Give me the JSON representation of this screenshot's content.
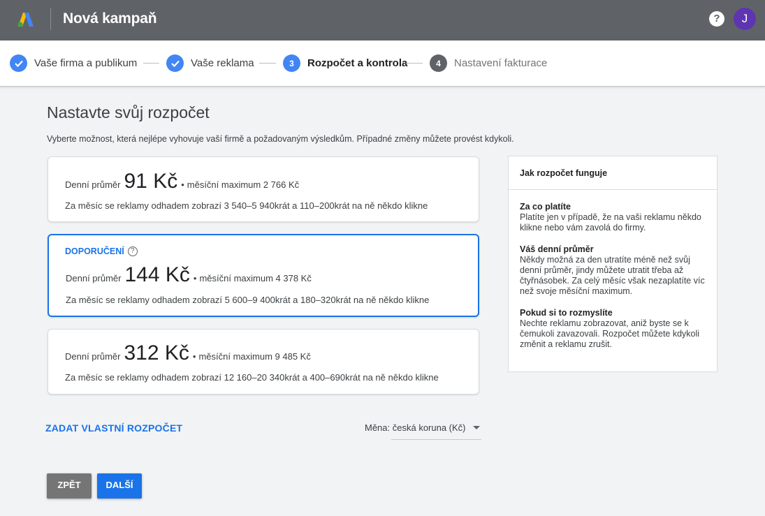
{
  "header": {
    "title": "Nová kampaň",
    "help_icon": "?",
    "avatar_initial": "J"
  },
  "stepper": {
    "steps": [
      {
        "label": "Vaše firma a publikum",
        "state": "done",
        "number": ""
      },
      {
        "label": "Vaše reklama",
        "state": "done",
        "number": ""
      },
      {
        "label": "Rozpočet a kontrola",
        "state": "active",
        "number": "3"
      },
      {
        "label": "Nastavení fakturace",
        "state": "todo",
        "number": "4"
      }
    ]
  },
  "main": {
    "title": "Nastavte svůj rozpočet",
    "subtitle": "Vyberte možnost, která nejlépe vyhovuje vaší firmě a požadovaným výsledkům. Případné změny můžete provést kdykoli."
  },
  "options": [
    {
      "daily_label": "Denní průměr",
      "price": "91 Kč",
      "monthly": "měsíční maximum 2 766 Kč",
      "estimate": "Za měsíc se reklamy odhadem zobrazí 3 540–5 940krát a 110–200krát na ně někdo klikne",
      "selected": false
    },
    {
      "badge": "DOPORUČENÍ",
      "daily_label": "Denní průměr",
      "price": "144 Kč",
      "monthly": "měsíční maximum 4 378 Kč",
      "estimate": "Za měsíc se reklamy odhadem zobrazí 5 600–9 400krát a 180–320krát na ně někdo klikne",
      "selected": true
    },
    {
      "daily_label": "Denní průměr",
      "price": "312 Kč",
      "monthly": "měsíční maximum 9 485 Kč",
      "estimate": "Za měsíc se reklamy odhadem zobrazí 12 160–20 340krát a 400–690krát na ně někdo klikne",
      "selected": false
    }
  ],
  "side_panel": {
    "title": "Jak rozpočet funguje",
    "sections": [
      {
        "heading": "Za co platíte",
        "body": "Platíte jen v případě, že na vaši reklamu někdo klikne nebo vám zavolá do firmy."
      },
      {
        "heading": "Váš denní průměr",
        "body": "Někdy možná za den utratíte méně než svůj denní průměr, jindy můžete utratit třeba až čtyřnásobek. Za celý měsíc však nezaplatíte víc než svoje měsíční maximum."
      },
      {
        "heading": "Pokud si to rozmyslíte",
        "body": "Nechte reklamu zobrazovat, aniž byste se k čemukoli zavazovali. Rozpočet můžete kdykoli změnit a reklamu zrušit."
      }
    ]
  },
  "controls": {
    "custom_budget": "ZADAT VLASTNÍ ROZPOČET",
    "currency": "Měna: česká koruna (Kč)",
    "back": "ZPĚT",
    "next": "DALŠÍ"
  },
  "colors": {
    "topbar": "#5f6368",
    "accent": "#1a73e8",
    "step_done": "#4285f4",
    "avatar": "#5e35b1"
  }
}
